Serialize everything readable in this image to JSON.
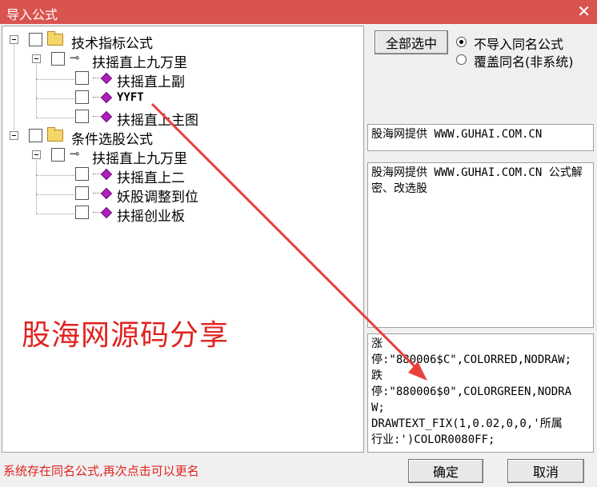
{
  "window": {
    "title": "导入公式",
    "close_symbol": "✕"
  },
  "tree": {
    "groups": [
      {
        "label": "技术指标公式",
        "formula": "扶摇直上九万里",
        "items": [
          "扶摇直上副",
          "YYFT",
          "扶摇直上主图"
        ]
      },
      {
        "label": "条件选股公式",
        "formula": "扶摇直上九万里",
        "items": [
          "扶摇直上二",
          "妖股调整到位",
          "扶摇创业板"
        ]
      }
    ]
  },
  "watermark": "股海网源码分享",
  "buttons": {
    "select_all": "全部选中",
    "ok": "确定",
    "cancel": "取消"
  },
  "options": {
    "no_import_same": "不导入同名公式",
    "overwrite_same": "覆盖同名(非系统)"
  },
  "info": {
    "provider": "股海网提供 WWW.GUHAI.COM.CN",
    "description": "股海网提供 WWW.GUHAI.COM.CN 公式解密、改选股",
    "code_lines": [
      "涨",
      "停:\"880006$C\",COLORRED,NODRAW;",
      "跌",
      "停:\"880006$0\",COLORGREEN,NODRA",
      "W;",
      "DRAWTEXT_FIX(1,0.02,0,0,'所属",
      "行业:')COLOR0080FF;"
    ]
  },
  "status": "系统存在同名公式,再次点击可以更名",
  "colors": {
    "titlebar": "#d9534f",
    "accent_red": "#e0231f",
    "gem": "#b01ec0",
    "folder": "#f6d56a"
  },
  "icons": [
    "close-icon",
    "folder-icon",
    "key-icon",
    "gem-icon"
  ]
}
